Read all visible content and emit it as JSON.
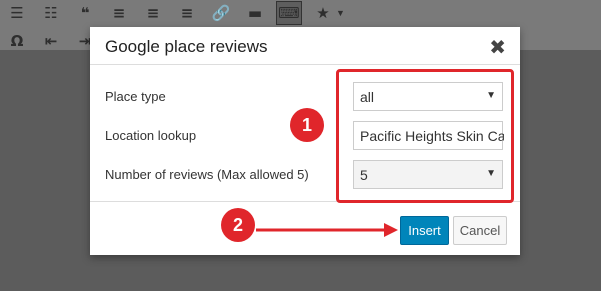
{
  "toolbar": {
    "row1": [
      "list-icon",
      "numbered-list-icon",
      "blockquote-icon",
      "align-left-icon",
      "align-center-icon",
      "align-right-icon",
      "link-icon",
      "read-more-icon",
      "keyboard-icon",
      "star-icon"
    ],
    "row2": [
      "omega-icon",
      "outdent-icon",
      "indent-icon"
    ]
  },
  "modal": {
    "title": "Google place reviews",
    "close_label": "✖",
    "fields": {
      "place_type": {
        "label": "Place type",
        "value": "all"
      },
      "location": {
        "label": "Location lookup",
        "value": "Pacific Heights Skin Car"
      },
      "reviews": {
        "label": "Number of reviews (Max allowed 5)",
        "value": "5"
      }
    },
    "buttons": {
      "insert": "Insert",
      "cancel": "Cancel"
    }
  },
  "annotations": {
    "step1": "1",
    "step2": "2",
    "color": "#e0262b"
  }
}
